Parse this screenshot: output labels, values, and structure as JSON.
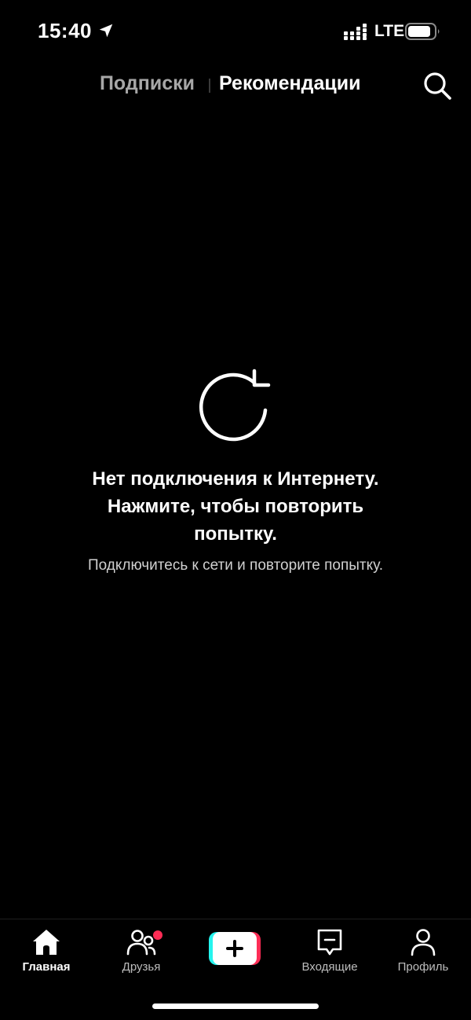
{
  "status_bar": {
    "time": "15:40",
    "network": "LTE"
  },
  "top_tabs": {
    "following": "Подписки",
    "for_you": "Рекомендации"
  },
  "error": {
    "title": "Нет подключения к Интернету. Нажмите, чтобы повторить попытку.",
    "subtitle": "Подключитесь к сети и повторите попытку."
  },
  "bottom_nav": {
    "home": "Главная",
    "friends": "Друзья",
    "inbox": "Входящие",
    "profile": "Профиль"
  },
  "icons": {
    "location": "location-arrow-icon",
    "signal": "cellular-signal-icon",
    "battery": "battery-icon",
    "search": "search-icon",
    "refresh": "refresh-icon",
    "home": "home-icon",
    "friends": "friends-icon",
    "create": "plus-icon",
    "inbox": "inbox-icon",
    "profile": "profile-icon"
  },
  "colors": {
    "background": "#000000",
    "accent_red": "#fe2c55",
    "accent_cyan": "#25f4ee",
    "inactive_tab": "#a7a7a7"
  }
}
